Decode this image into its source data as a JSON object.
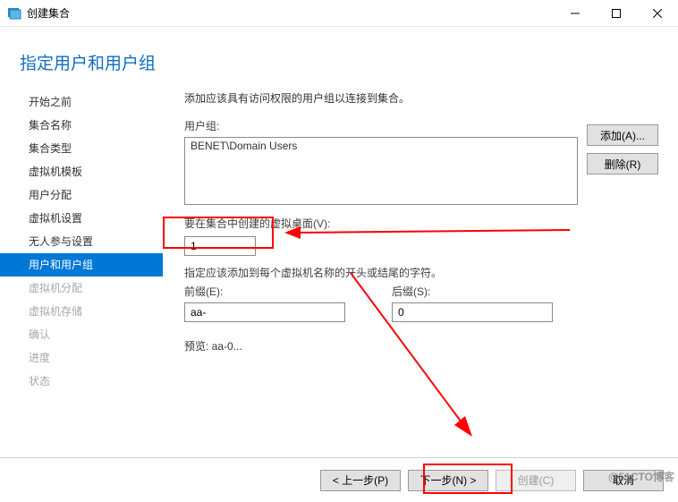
{
  "window": {
    "title": "创建集合"
  },
  "header": {
    "title": "指定用户和用户组"
  },
  "sidebar": {
    "items": [
      {
        "label": "开始之前",
        "state": "enabled"
      },
      {
        "label": "集合名称",
        "state": "enabled"
      },
      {
        "label": "集合类型",
        "state": "enabled"
      },
      {
        "label": "虚拟机模板",
        "state": "enabled"
      },
      {
        "label": "用户分配",
        "state": "enabled"
      },
      {
        "label": "虚拟机设置",
        "state": "enabled"
      },
      {
        "label": "无人参与设置",
        "state": "enabled"
      },
      {
        "label": "用户和用户组",
        "state": "active"
      },
      {
        "label": "虚拟机分配",
        "state": "disabled"
      },
      {
        "label": "虚拟机存储",
        "state": "disabled"
      },
      {
        "label": "确认",
        "state": "disabled"
      },
      {
        "label": "进度",
        "state": "disabled"
      },
      {
        "label": "状态",
        "state": "disabled"
      }
    ]
  },
  "main": {
    "instruction": "添加应该具有访问权限的用户组以连接到集合。",
    "usergroups_label": "用户组:",
    "usergroups": [
      "BENET\\Domain Users"
    ],
    "add_button": "添加(A)...",
    "remove_button": "删除(R)",
    "vd_count_label": "要在集合中创建的虚拟桌面(V):",
    "vd_count_value": "1",
    "naming_instruction": "指定应该添加到每个虚拟机名称的开头或结尾的字符。",
    "prefix_label": "前缀(E):",
    "prefix_value": "aa-",
    "suffix_label": "后缀(S):",
    "suffix_value": "0",
    "preview_label": "预览: ",
    "preview_value": "aa-0..."
  },
  "footer": {
    "prev": "< 上一步(P)",
    "next": "下一步(N) >",
    "create": "创建(C)",
    "cancel": "取消"
  },
  "watermark": "@51CTO博客"
}
